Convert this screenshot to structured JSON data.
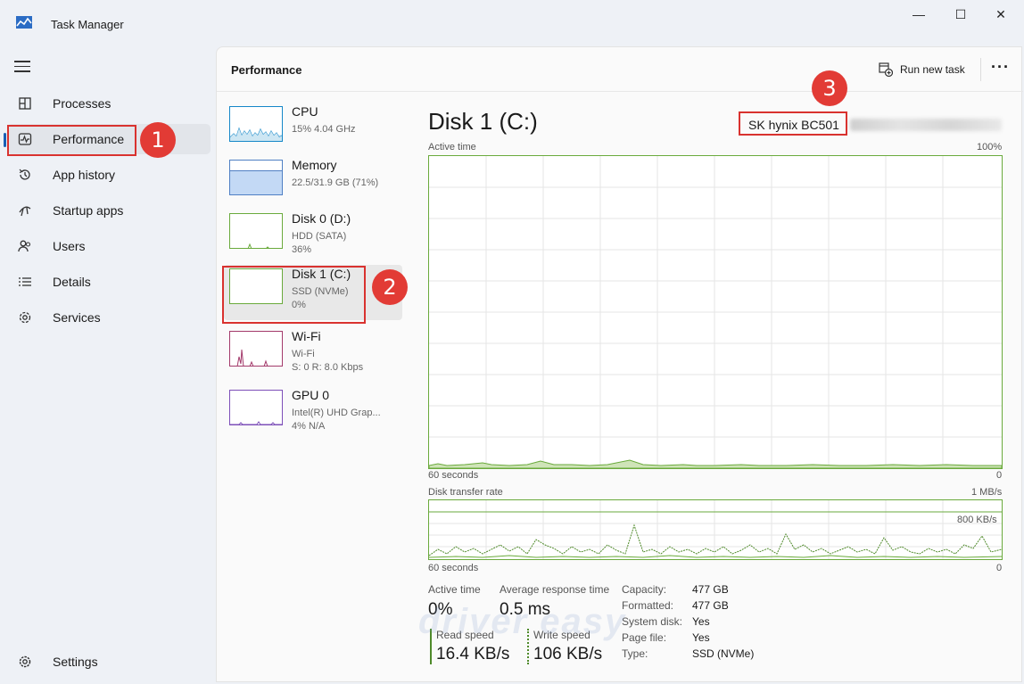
{
  "window": {
    "title": "Task Manager",
    "minimize": "—",
    "maximize": "☐",
    "close": "✕"
  },
  "sidebar": {
    "items": [
      {
        "label": "Processes",
        "icon": "processes-icon"
      },
      {
        "label": "Performance",
        "icon": "performance-icon"
      },
      {
        "label": "App history",
        "icon": "history-icon"
      },
      {
        "label": "Startup apps",
        "icon": "startup-icon"
      },
      {
        "label": "Users",
        "icon": "users-icon"
      },
      {
        "label": "Details",
        "icon": "details-icon"
      },
      {
        "label": "Services",
        "icon": "services-icon"
      }
    ],
    "settings_label": "Settings"
  },
  "header": {
    "title": "Performance",
    "run_new_task": "Run new task",
    "more": "···"
  },
  "resources": [
    {
      "name": "CPU",
      "sub1": "15% 4.04 GHz",
      "sub2": ""
    },
    {
      "name": "Memory",
      "sub1": "22.5/31.9 GB (71%)",
      "sub2": ""
    },
    {
      "name": "Disk 0 (D:)",
      "sub1": "HDD (SATA)",
      "sub2": "36%"
    },
    {
      "name": "Disk 1 (C:)",
      "sub1": "SSD (NVMe)",
      "sub2": "0%"
    },
    {
      "name": "Wi-Fi",
      "sub1": "Wi-Fi",
      "sub2": "S: 0 R: 8.0 Kbps"
    },
    {
      "name": "GPU 0",
      "sub1": "Intel(R) UHD Grap...",
      "sub2": "4% N/A"
    }
  ],
  "detail": {
    "title": "Disk 1 (C:)",
    "model": "SK hynix BC501",
    "active_time_graph": {
      "label": "Active time",
      "max": "100%",
      "x_left": "60 seconds",
      "x_right": "0"
    },
    "transfer_graph": {
      "label": "Disk transfer rate",
      "max": "1 MB/s",
      "mid": "800 KB/s",
      "x_left": "60 seconds",
      "x_right": "0"
    },
    "stats": {
      "active_time_label": "Active time",
      "active_time_value": "0%",
      "avg_response_label": "Average response time",
      "avg_response_value": "0.5 ms",
      "read_speed_label": "Read speed",
      "read_speed_value": "16.4 KB/s",
      "write_speed_label": "Write speed",
      "write_speed_value": "106 KB/s"
    },
    "properties": [
      {
        "label": "Capacity:",
        "value": "477 GB"
      },
      {
        "label": "Formatted:",
        "value": "477 GB"
      },
      {
        "label": "System disk:",
        "value": "Yes"
      },
      {
        "label": "Page file:",
        "value": "Yes"
      },
      {
        "label": "Type:",
        "value": "SSD (NVMe)"
      }
    ]
  },
  "annotations": {
    "badge1": "1",
    "badge2": "2",
    "badge3": "3",
    "watermark": "driver easy"
  },
  "colors": {
    "accent": "#1a5fb4",
    "disk_green": "#6aaa3c",
    "annotation_red": "#d9322f"
  }
}
